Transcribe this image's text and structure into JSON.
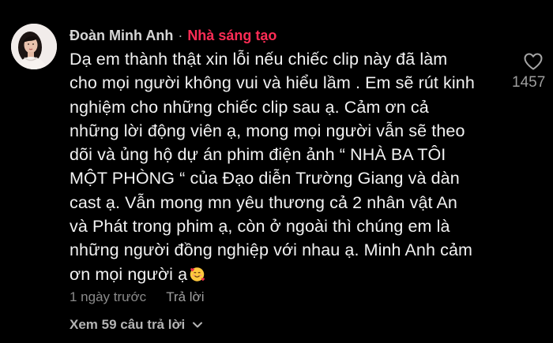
{
  "comment": {
    "author": "Đoàn Minh Anh",
    "separator": "·",
    "badge": "Nhà sáng tạo",
    "text": "Dạ em thành thật xin lỗi nếu chiếc clip này đã làm\ncho mọi người không vui và hiểu lầm . Em sẽ rút kinh\nnghiệm cho những chiếc clip sau ạ. Cảm ơn cả\nnhững lời động viên ạ, mong mọi người vẫn sẽ theo\ndõi và ủng hộ dự án phim điện ảnh “ NHÀ BA TÔI\nMỘT PHÒNG “ của Đạo diễn Trường Giang và dàn\ncast ạ. Vẫn mong mn yêu thương cả 2 nhân vật An\nvà Phát trong phim ạ, còn ở ngoài thì chúng em là\nnhững người đồng nghiệp với nhau ạ. Minh Anh cảm\nơn mọi người ạ",
    "emoji_icon": "smiling-face-with-hearts-icon",
    "like_count": "1457",
    "timestamp": "1 ngày trước",
    "reply_label": "Trả lời",
    "view_replies": "Xem 59 câu trả lời"
  },
  "colors": {
    "background": "#000000",
    "author": "#d6d6d6",
    "badge": "#fe2c55",
    "text": "#f2f2f2",
    "muted": "#8a8a8a"
  },
  "icons": {
    "avatar": "avatar",
    "like": "heart-outline-icon",
    "expand": "chevron-down-icon"
  }
}
